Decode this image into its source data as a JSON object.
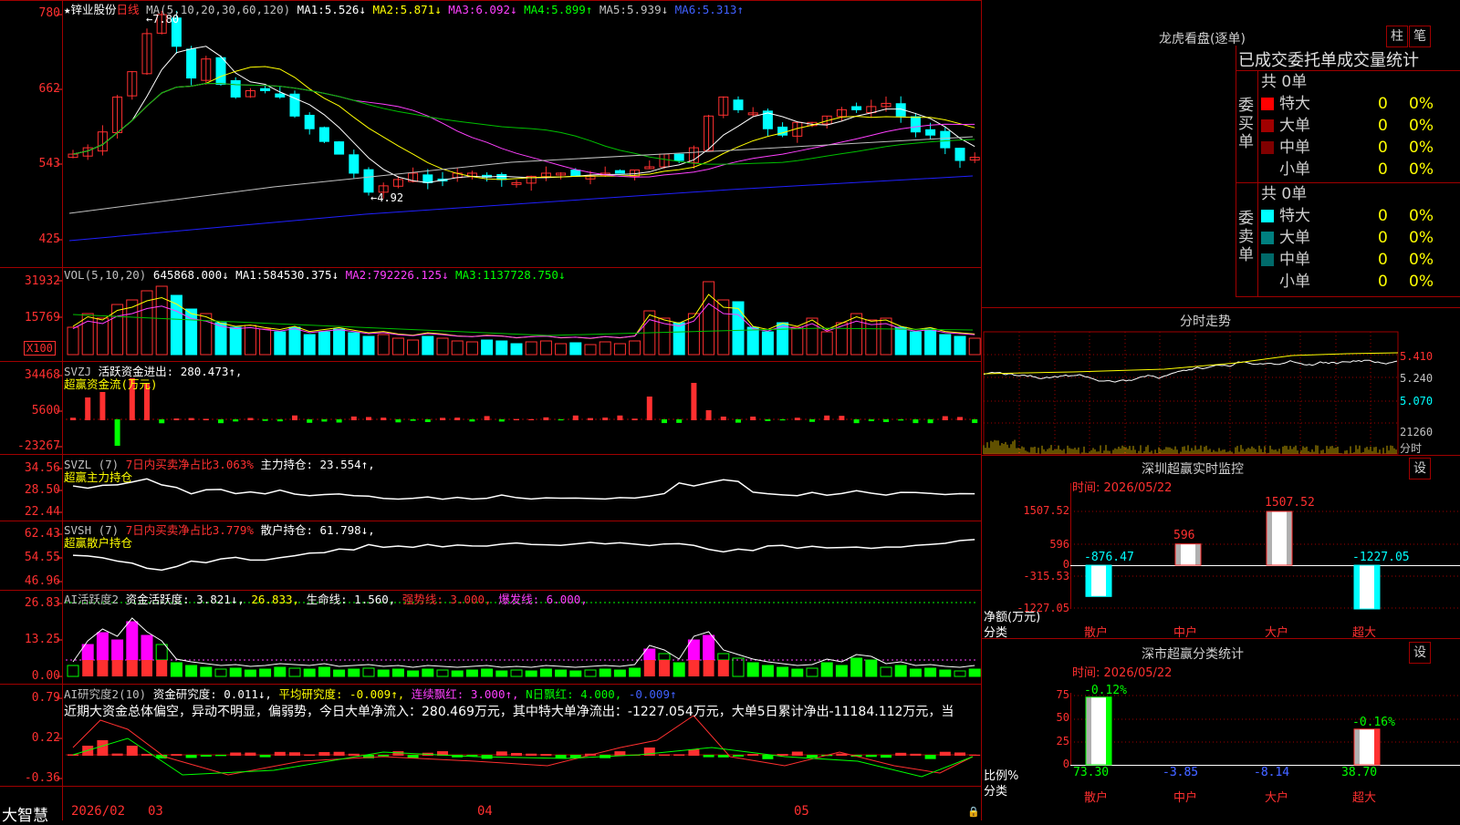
{
  "app": {
    "brand": "大智慧"
  },
  "colors": {
    "up": "#ff3030",
    "down": "#00ffff",
    "grid": "#a00000",
    "ma1": "#ffffff",
    "ma2": "#ffff00",
    "ma3": "#ff40ff",
    "ma4": "#00c000",
    "ma5": "#c0c0c0",
    "ma6": "#2020ff"
  },
  "main": {
    "star": "★",
    "stock": "锌业股份",
    "period": "日线",
    "ma_label": "MA(5,10,20,30,60,120)",
    "ma": [
      {
        "label": "MA1:",
        "value": "5.526↓"
      },
      {
        "label": "MA2:",
        "value": "5.871↓"
      },
      {
        "label": "MA3:",
        "value": "6.092↓"
      },
      {
        "label": "MA4:",
        "value": "5.899↑"
      },
      {
        "label": "MA5:",
        "value": "5.939↓"
      },
      {
        "label": "MA6:",
        "value": "5.313↑"
      }
    ],
    "axis": [
      "780",
      "662",
      "543",
      "425"
    ],
    "high_mark": "←7.80",
    "low_mark": "←4.92"
  },
  "vol": {
    "label": "VOL(5,10,20)",
    "value": "645868.000↓",
    "ma": [
      {
        "label": "MA1:",
        "value": "584530.375↓"
      },
      {
        "label": "MA2:",
        "value": "792226.125↓"
      },
      {
        "label": "MA3:",
        "value": "1137728.750↓"
      }
    ],
    "axis": [
      "31932",
      "15769"
    ],
    "unit": "X100"
  },
  "svzj": {
    "label": "SVZJ",
    "text": "活跃资金进出:",
    "value": "280.473↑,",
    "subtitle": "超赢资金流(万元)",
    "axis": [
      "34468",
      "5600",
      "-23267"
    ]
  },
  "svzl": {
    "label": "SVZL (7)",
    "ratio_text": "7日内买卖净占比3.063%",
    "hold_label": "主力持仓:",
    "hold_value": "23.554↑,",
    "subtitle": "超赢主力持仓",
    "axis": [
      "34.56",
      "28.50",
      "22.44"
    ]
  },
  "svsh": {
    "label": "SVSH (7)",
    "ratio_text": "7日内买卖净占比3.779%",
    "hold_label": "散户持仓:",
    "hold_value": "61.798↓,",
    "subtitle": "超赢散户持仓",
    "axis": [
      "62.43",
      "54.55",
      "46.96"
    ]
  },
  "ai1": {
    "label": "AI活跃度2",
    "act_label": "资金活跃度:",
    "act_value": "3.821↓,",
    "v2": "26.833,",
    "life_label": "生命线:",
    "life_value": "1.560,",
    "strong": "强势线: 3.000,",
    "burst": "爆发线: 6.000,",
    "axis": [
      "26.83",
      "13.25",
      "0.00"
    ]
  },
  "ai2": {
    "label": "AI研究度2(10)",
    "res_label": "资金研究度:",
    "res_value": "0.011↓,",
    "avg": "平均研究度: -0.009↑,",
    "lianxu": "连续飘红: 3.000↑,",
    "nday": "N日飘红: 4.000,",
    "last": "-0.009↑",
    "summary": "近期大资金总体偏空，异动不明显，偏弱势，今日大单净流入：280.469万元，其中特大单净流出：-1227.054万元，大单5日累计净出-11184.112万元，当",
    "axis": [
      "0.79",
      "0.22",
      "-0.36"
    ]
  },
  "dates": [
    "2026/02",
    "03",
    "04",
    "05"
  ],
  "lhb": {
    "title": "龙虎看盘(逐单)",
    "btn_col": "柱",
    "btn_pen": "笔",
    "header": "已成交委托单成交量统计",
    "buy": {
      "side_label": "委买单",
      "total": "共 0单",
      "rows": [
        {
          "name": "特大",
          "count": "0",
          "pct": "0%",
          "color": "#ff0000"
        },
        {
          "name": "大单",
          "count": "0",
          "pct": "0%",
          "color": "#a00000"
        },
        {
          "name": "中单",
          "count": "0",
          "pct": "0%",
          "color": "#800000"
        },
        {
          "name": "小单",
          "count": "0",
          "pct": "0%",
          "color": "#000000"
        }
      ]
    },
    "sell": {
      "side_label": "委卖单",
      "total": "共 0单",
      "rows": [
        {
          "name": "特大",
          "count": "0",
          "pct": "0%",
          "color": "#00ffff"
        },
        {
          "name": "大单",
          "count": "0",
          "pct": "0%",
          "color": "#008080"
        },
        {
          "name": "中单",
          "count": "0",
          "pct": "0%",
          "color": "#006a6a"
        },
        {
          "name": "小单",
          "count": "0",
          "pct": "0%",
          "color": "#000000"
        }
      ]
    }
  },
  "intraday": {
    "title": "分时走势",
    "axis": [
      "5.410",
      "5.240",
      "5.070"
    ],
    "vol_axis": "21260",
    "vol_unit": "分时"
  },
  "sz_monitor": {
    "title": "深圳超赢实时监控",
    "btn": "设",
    "time": "时间: 2026/05/22",
    "axis": [
      "1507.52",
      "596",
      "0",
      "-315.53",
      "-1227.05"
    ],
    "ylabel": "净额(万元)",
    "xlabel": "分类",
    "chart_data": {
      "type": "bar",
      "categories": [
        "散户",
        "中户",
        "大户",
        "超大"
      ],
      "values": [
        -876.47,
        596,
        1507.52,
        -1227.05
      ],
      "labels": [
        "-876.47",
        "596",
        "1507.52",
        "-1227.05"
      ],
      "ylim": [
        -1227.05,
        1507.52
      ]
    }
  },
  "sz_class": {
    "title": "深市超赢分类统计",
    "btn": "设",
    "time": "时间: 2026/05/22",
    "axis": [
      "75",
      "50",
      "25",
      "0"
    ],
    "ylabel": "比例%",
    "xlabel": "分类",
    "chart_data": {
      "type": "bar",
      "categories": [
        "散户",
        "中户",
        "大户",
        "超大"
      ],
      "values": [
        73.3,
        -3.85,
        -8.14,
        38.7
      ],
      "values_label": [
        "73.30",
        "-3.85",
        "-8.14",
        "38.70"
      ],
      "changes": [
        "-0.12%",
        "",
        "",
        "-0.16%"
      ],
      "ylim": [
        0,
        75
      ]
    }
  }
}
